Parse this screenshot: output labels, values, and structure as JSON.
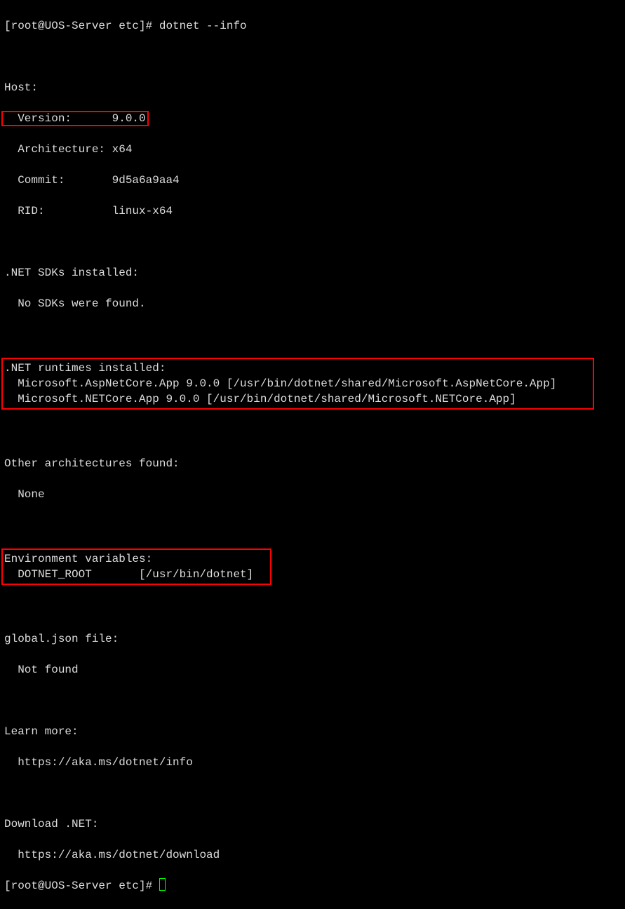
{
  "prompt_line1": "[root@UOS-Server etc]# dotnet --info",
  "host_header": "Host:",
  "host_version_label": "  Version:      ",
  "host_version_value": "9.0.0",
  "host_architecture": "  Architecture: x64",
  "host_commit": "  Commit:       9d5a6a9aa4",
  "host_rid": "  RID:          linux-x64",
  "sdks_header": ".NET SDKs installed:",
  "sdks_none": "  No SDKs were found.",
  "runtimes_header": ".NET runtimes installed:",
  "runtime_aspnet": "  Microsoft.AspNetCore.App 9.0.0 [/usr/bin/dotnet/shared/Microsoft.AspNetCore.App]",
  "runtime_netcore": "  Microsoft.NETCore.App 9.0.0 [/usr/bin/dotnet/shared/Microsoft.NETCore.App]",
  "other_arch_header": "Other architectures found:",
  "other_arch_none": "  None",
  "env_header": "Environment variables:",
  "env_dotnet_root": "  DOTNET_ROOT       [/usr/bin/dotnet]",
  "global_json_header": "global.json file:",
  "global_json_not_found": "  Not found",
  "learn_more_header": "Learn more:",
  "learn_more_url": "  https://aka.ms/dotnet/info",
  "download_header": "Download .NET:",
  "download_url": "  https://aka.ms/dotnet/download",
  "prompt_line2": "[root@UOS-Server etc]# "
}
